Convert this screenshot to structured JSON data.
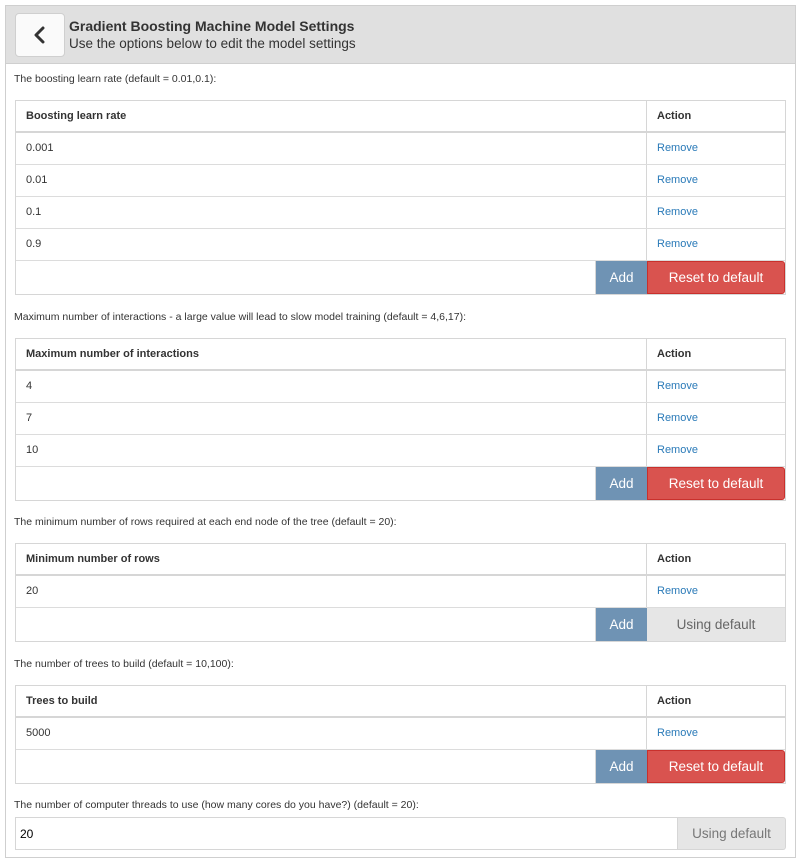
{
  "header": {
    "title": "Gradient Boosting Machine Model Settings",
    "subtitle": "Use the options below to edit the model settings",
    "back_icon": "chevron-left-icon"
  },
  "learn_rate": {
    "label": "The boosting learn rate (default = 0.01,0.1):",
    "column_header": "Boosting learn rate",
    "action_header": "Action",
    "rows": [
      {
        "value": "0.001",
        "action": "Remove"
      },
      {
        "value": "0.01",
        "action": "Remove"
      },
      {
        "value": "0.1",
        "action": "Remove"
      },
      {
        "value": "0.9",
        "action": "Remove"
      }
    ],
    "input_value": "",
    "add_label": "Add",
    "reset_label": "Reset to default"
  },
  "interactions": {
    "label": "Maximum number of interactions - a large value will lead to slow model training (default = 4,6,17):",
    "column_header": "Maximum number of interactions",
    "action_header": "Action",
    "rows": [
      {
        "value": "4",
        "action": "Remove"
      },
      {
        "value": "7",
        "action": "Remove"
      },
      {
        "value": "10",
        "action": "Remove"
      }
    ],
    "input_value": "",
    "add_label": "Add",
    "reset_label": "Reset to default"
  },
  "min_rows": {
    "label": "The minimum number of rows required at each end node of the tree (default = 20):",
    "column_header": "Minimum number of rows",
    "action_header": "Action",
    "rows": [
      {
        "value": "20",
        "action": "Remove"
      }
    ],
    "input_value": "",
    "add_label": "Add",
    "default_label": "Using default"
  },
  "trees": {
    "label": "The number of trees to build (default = 10,100):",
    "column_header": "Trees to build",
    "action_header": "Action",
    "rows": [
      {
        "value": "5000",
        "action": "Remove"
      }
    ],
    "input_value": "",
    "add_label": "Add",
    "reset_label": "Reset to default"
  },
  "threads": {
    "label": "The number of computer threads to use (how many cores do you have?) (default = 20):",
    "input_value": "20",
    "default_label": "Using default"
  },
  "colors": {
    "header_bg": "#e0e0e0",
    "add_button": "#6f93b4",
    "reset_button": "#d9534f",
    "default_button": "#e6e6e6",
    "link": "#2a7ab8"
  }
}
